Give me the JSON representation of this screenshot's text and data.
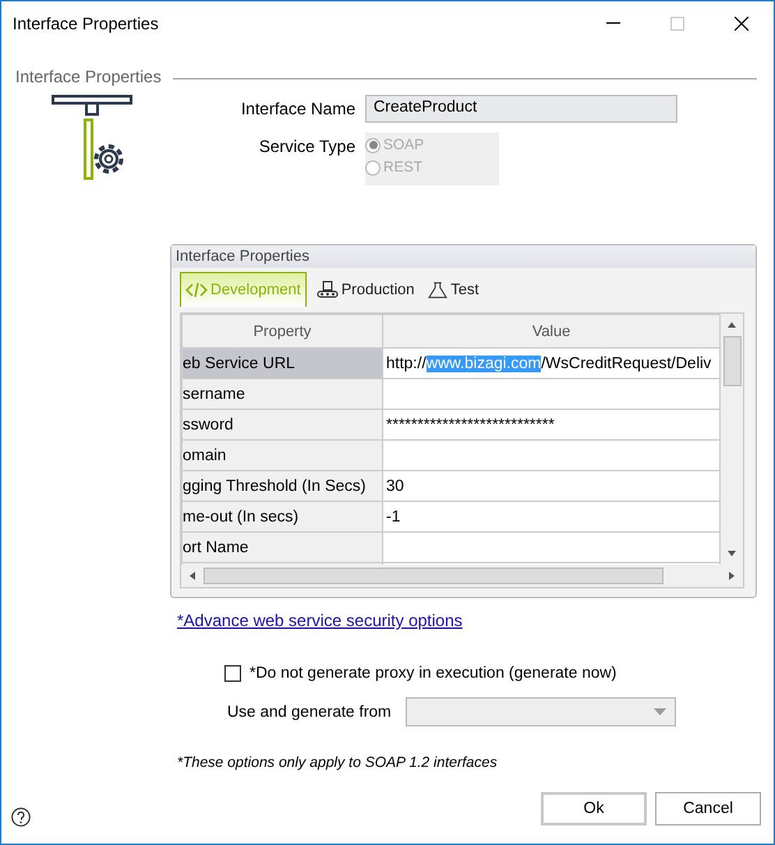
{
  "window": {
    "title": "Interface Properties"
  },
  "group_title": "Interface Properties",
  "interface_name": {
    "label": "Interface Name",
    "value": "CreateProduct"
  },
  "service_type": {
    "label": "Service Type",
    "options": [
      {
        "label": "SOAP",
        "selected": true
      },
      {
        "label": "REST",
        "selected": false
      }
    ]
  },
  "panel": {
    "title": "Interface Properties",
    "tabs": [
      {
        "label": "Development",
        "selected": true
      },
      {
        "label": "Production",
        "selected": false
      },
      {
        "label": "Test",
        "selected": false
      }
    ],
    "columns": [
      "Property",
      "Value"
    ],
    "rows": [
      {
        "property": "eb Service URL",
        "selected": true,
        "value_parts": [
          {
            "text": "http://",
            "selected": false
          },
          {
            "text": "www.bizagi.com",
            "selected": true
          },
          {
            "text": "/WsCreditRequest/Deliv",
            "selected": false
          }
        ]
      },
      {
        "property": "sername",
        "selected": false,
        "value_parts": []
      },
      {
        "property": "ssword",
        "selected": false,
        "value_parts": [
          {
            "text": "***************************",
            "selected": false
          }
        ]
      },
      {
        "property": "omain",
        "selected": false,
        "value_parts": []
      },
      {
        "property": "gging Threshold (In Secs)",
        "selected": false,
        "value_parts": [
          {
            "text": "30",
            "selected": false
          }
        ]
      },
      {
        "property": "me-out (In secs)",
        "selected": false,
        "value_parts": [
          {
            "text": "-1",
            "selected": false
          }
        ]
      },
      {
        "property": "ort Name",
        "selected": false,
        "value_parts": []
      }
    ]
  },
  "security_link": "*Advance web service security options",
  "no_proxy": {
    "label": "*Do not generate proxy in execution (generate now)",
    "checked": false
  },
  "generate_from": {
    "label": "Use and generate from"
  },
  "note": "*These options only apply to SOAP 1.2 interfaces",
  "buttons": [
    "Ok",
    "Cancel"
  ]
}
